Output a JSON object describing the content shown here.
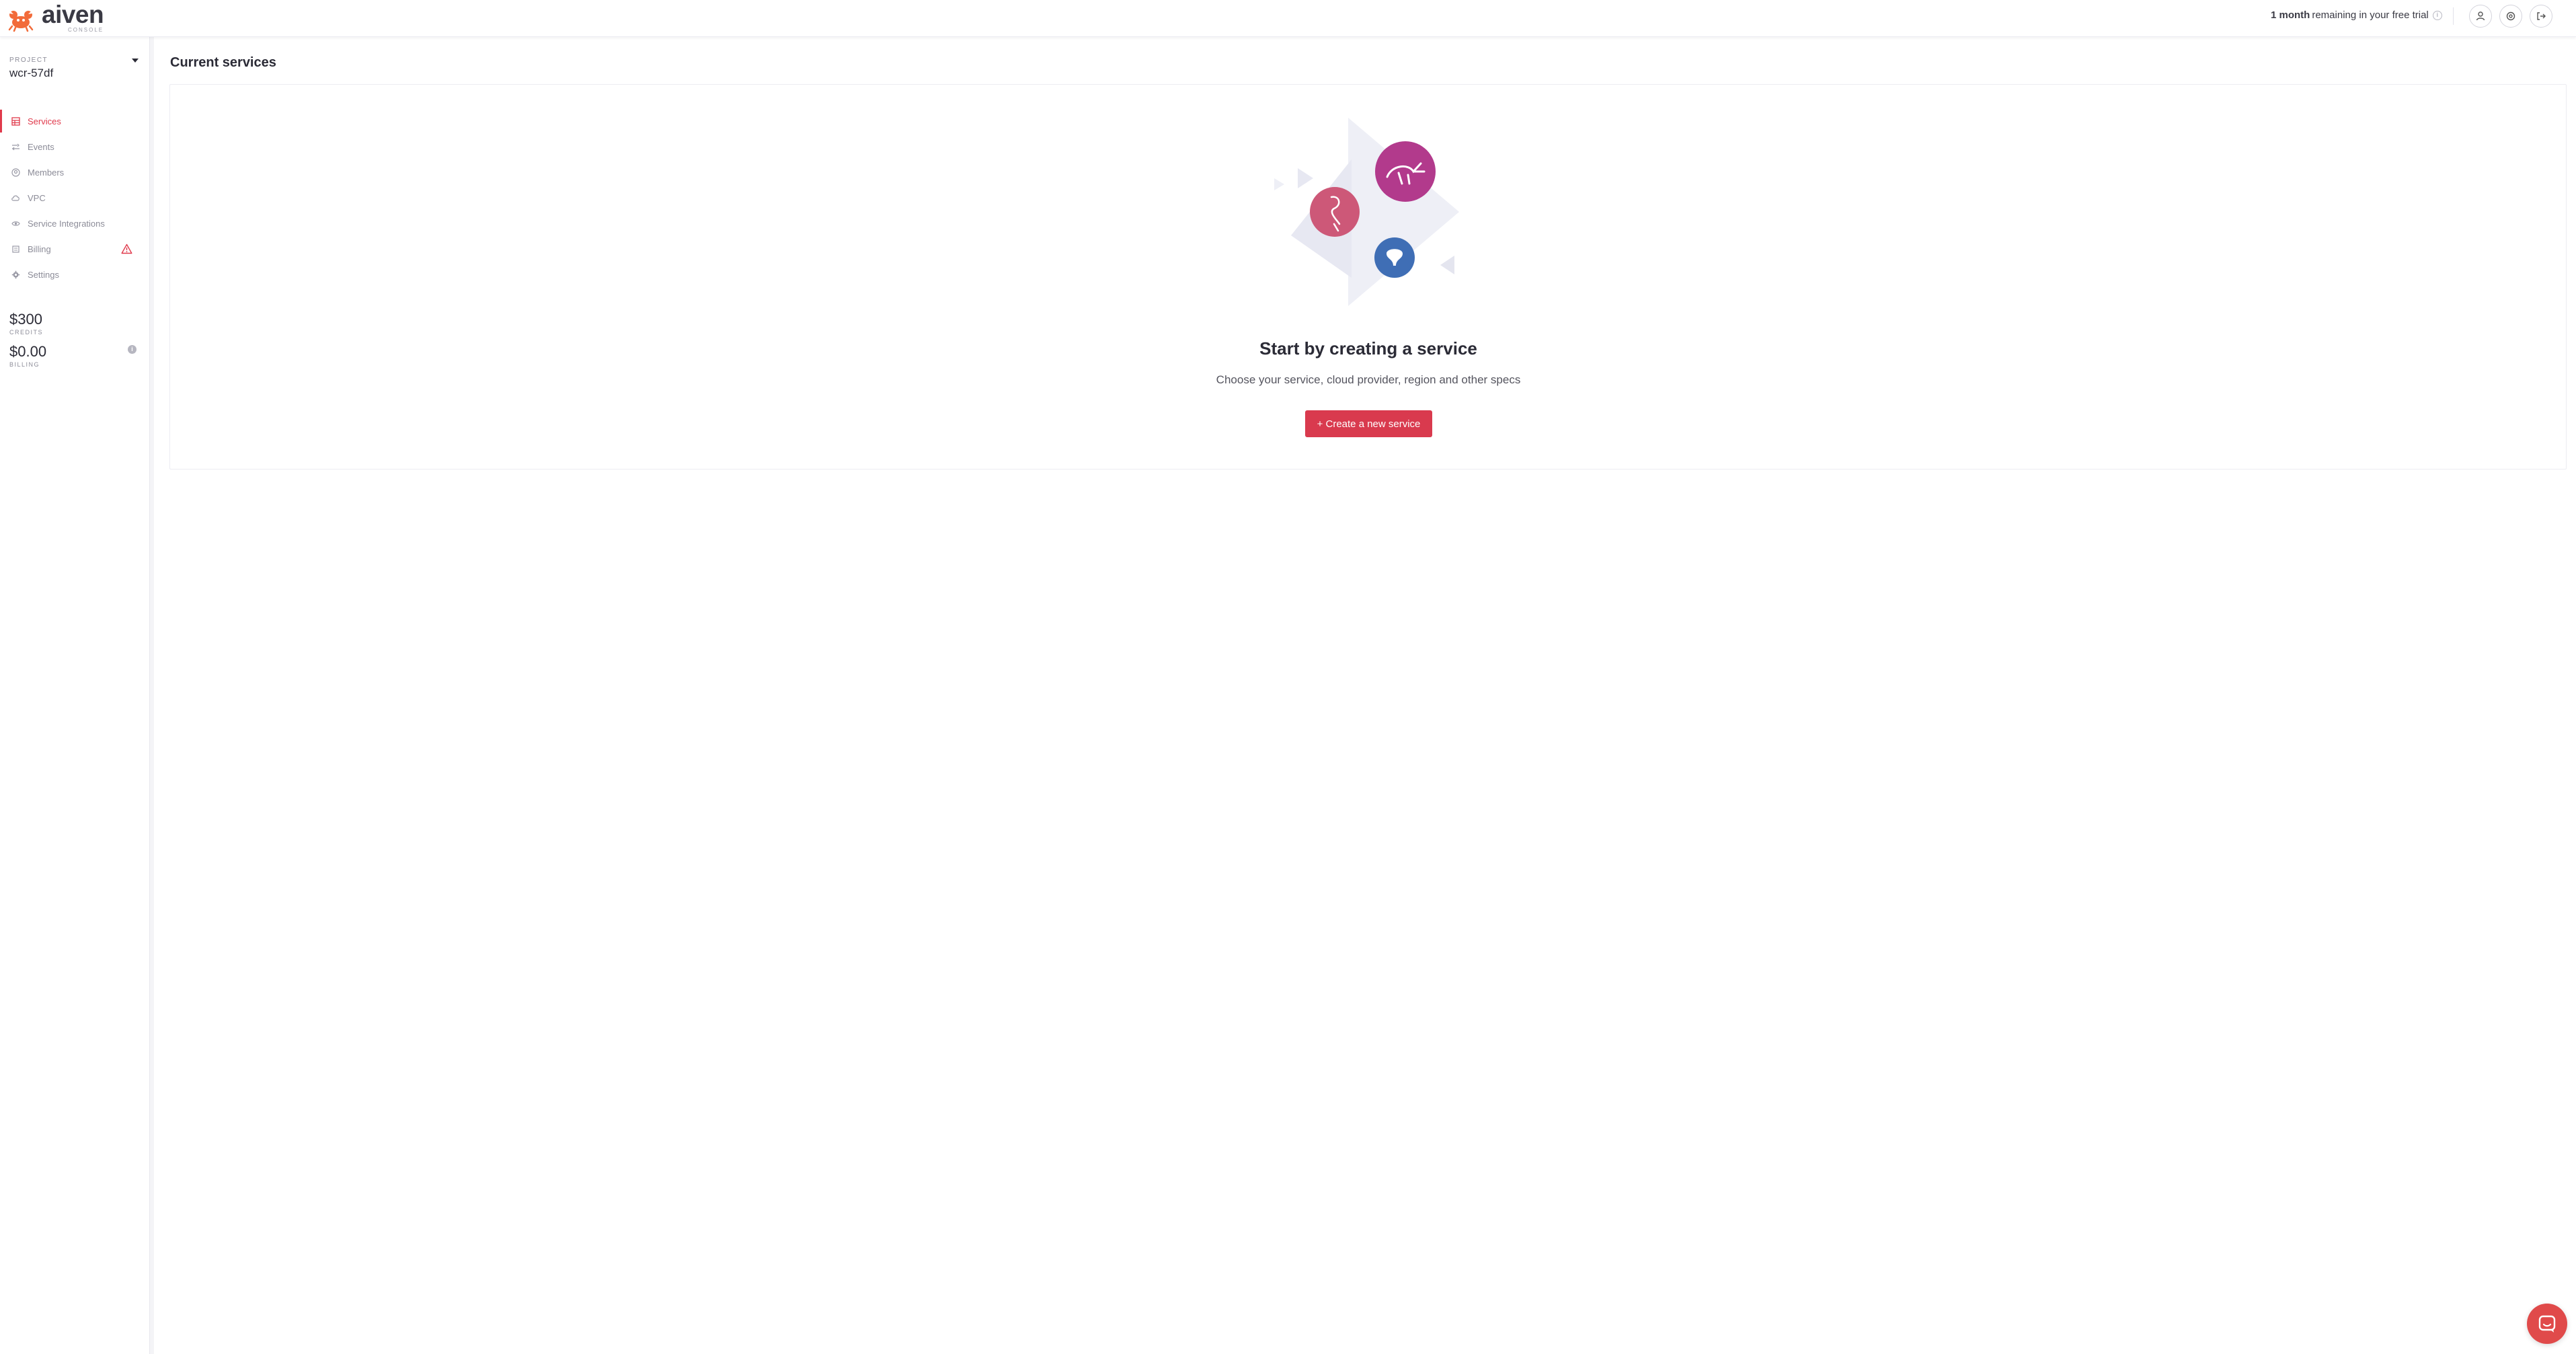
{
  "header": {
    "brand_name": "aiven",
    "brand_sub": "CONSOLE",
    "trial_bold": "1 month",
    "trial_rest": "remaining in your free trial",
    "trial_info": "i",
    "buttons": [
      {
        "icon": "user-icon"
      },
      {
        "icon": "settings-icon"
      },
      {
        "icon": "logout-icon"
      }
    ]
  },
  "sidebar": {
    "project_label": "PROJECT",
    "project_name": "wcr-57df",
    "items": [
      {
        "label": "Services",
        "icon": "services-icon",
        "active": true
      },
      {
        "label": "Events",
        "icon": "events-icon"
      },
      {
        "label": "Members",
        "icon": "members-icon"
      },
      {
        "label": "VPC",
        "icon": "cloud-icon"
      },
      {
        "label": "Service Integrations",
        "icon": "integrations-icon"
      },
      {
        "label": "Billing",
        "icon": "billing-icon",
        "warning": true
      },
      {
        "label": "Settings",
        "icon": "gear-icon"
      }
    ],
    "credits_value": "$300",
    "credits_label": "CREDITS",
    "billing_value": "$0.00",
    "billing_label": "BILLING",
    "billing_info": "i"
  },
  "main": {
    "title": "Current services",
    "empty_title": "Start by creating a service",
    "empty_subtitle": "Choose your service, cloud provider, region and other specs",
    "create_button": "+ Create a new service"
  },
  "colors": {
    "accent": "#e03a4c",
    "button": "#d93a4e",
    "chat": "#e04a4a"
  }
}
